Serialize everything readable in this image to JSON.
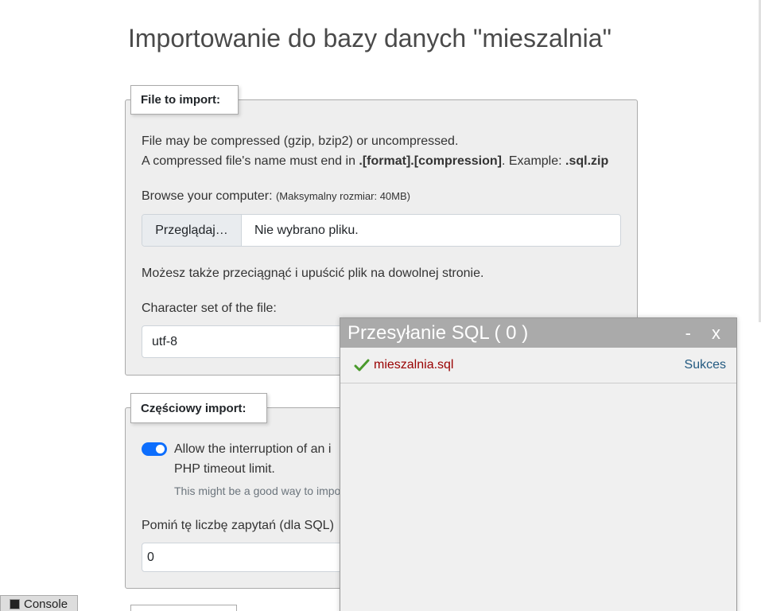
{
  "page": {
    "title": "Importowanie do bazy danych \"mieszalnia\""
  },
  "file_section": {
    "legend": "File to import:",
    "compress_note_line1": "File may be compressed (gzip, bzip2) or uncompressed.",
    "compress_note_line2_prefix": "A compressed file's name must end in ",
    "compress_note_format": ".[format].[compression]",
    "compress_note_example_label": ". Example: ",
    "compress_note_example": ".sql.zip",
    "browse_label": "Browse your computer:",
    "max_size": "(Maksymalny rozmiar: 40MB)",
    "browse_button": "Przeglądaj…",
    "no_file": "Nie wybrano pliku.",
    "drag_drop_note": "Możesz także przeciągnąć i upuścić plik na dowolnej stronie.",
    "charset_label": "Character set of the file:",
    "charset_value": "utf-8"
  },
  "partial_section": {
    "legend": "Częściowy import:",
    "allow_interrupt_line1": "Allow the interruption of an i",
    "allow_interrupt_line2": "PHP timeout limit.",
    "allow_interrupt_hint": "This might be a good way to impo",
    "allow_interrupt_checked": true,
    "skip_label": "Pomiń tę liczbę zapytań (dla SQL)",
    "skip_value": "0"
  },
  "upload_dialog": {
    "title": "Przesyłanie SQL ( 0 )",
    "minimize": "-",
    "close": "x",
    "files": [
      {
        "name": "mieszalnia.sql",
        "status": "Sukces",
        "icon": "check-icon"
      }
    ]
  },
  "console": {
    "label": "Console"
  },
  "colors": {
    "accent": "#0d6efd",
    "file_link": "#990000",
    "status_link": "#235a81",
    "dialog_header": "#aaaaaa",
    "check": "#4a9a2c"
  }
}
